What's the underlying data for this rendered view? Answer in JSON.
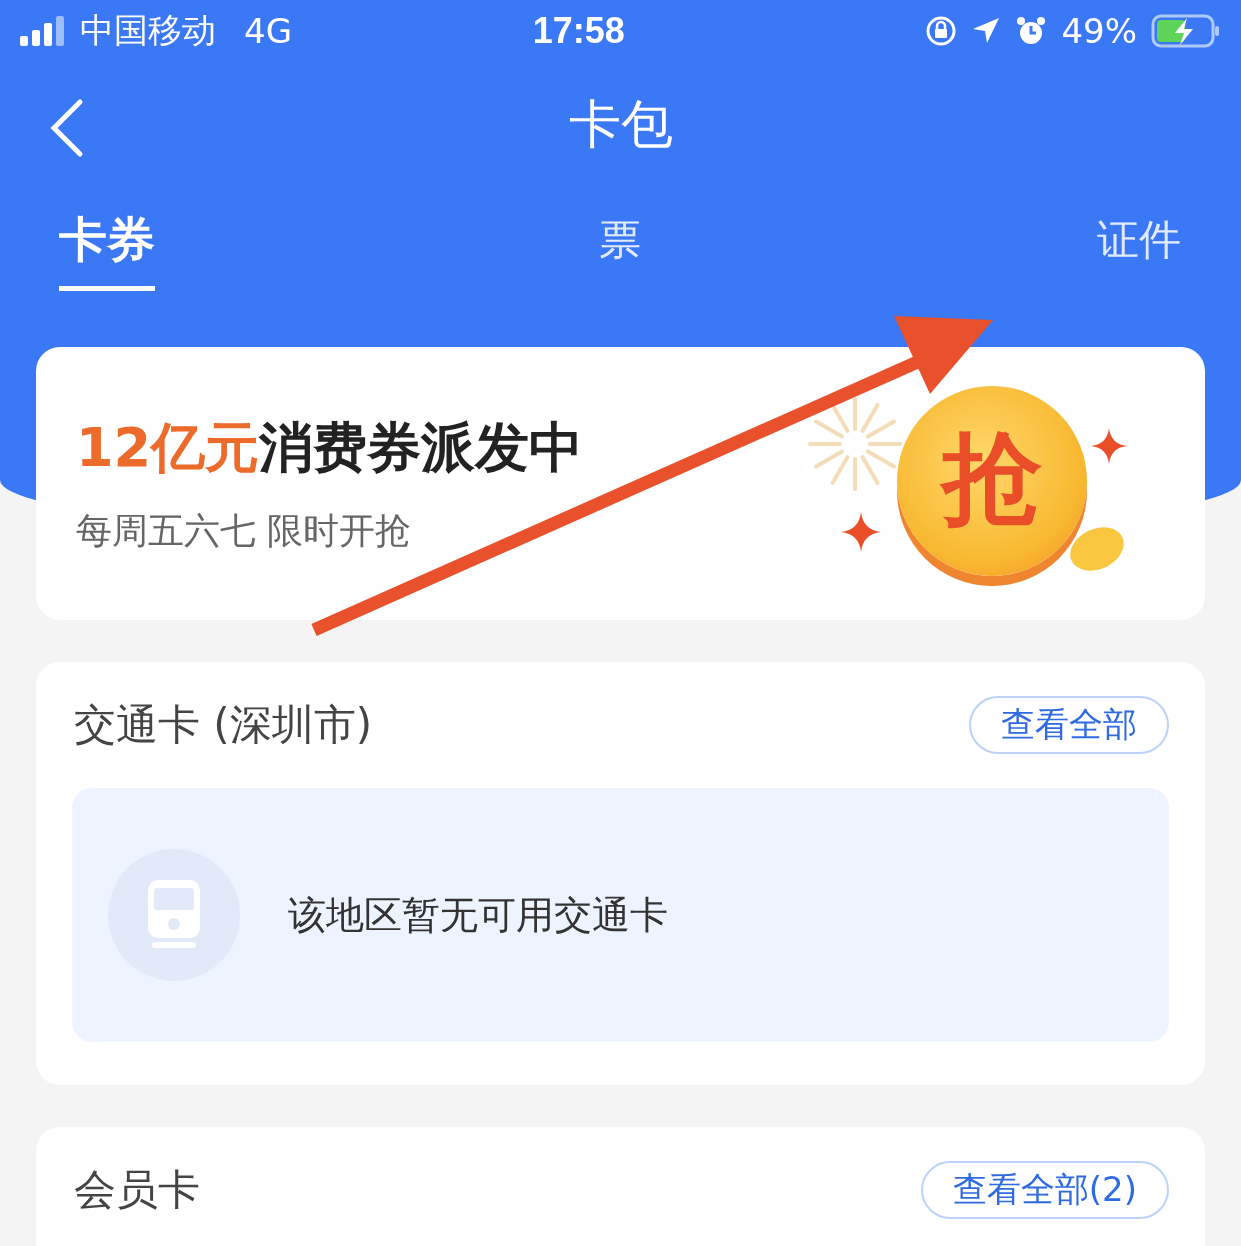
{
  "status_bar": {
    "carrier": "中国移动",
    "network": "4G",
    "time": "17:58",
    "battery": "49%"
  },
  "nav": {
    "title": "卡包"
  },
  "tabs": [
    {
      "label": "卡券",
      "selected": true
    },
    {
      "label": "票",
      "selected": false
    },
    {
      "label": "证件",
      "selected": false
    }
  ],
  "promo": {
    "highlight": "12亿元",
    "title": "消费券派发中",
    "subtitle": "每周五六七 限时开抢",
    "coin_label": "抢"
  },
  "sections": [
    {
      "title": "交通卡 (深圳市)",
      "button": "查看全部",
      "empty_text": "该地区暂无可用交通卡"
    },
    {
      "title": "会员卡",
      "button": "查看全部(2)"
    }
  ]
}
